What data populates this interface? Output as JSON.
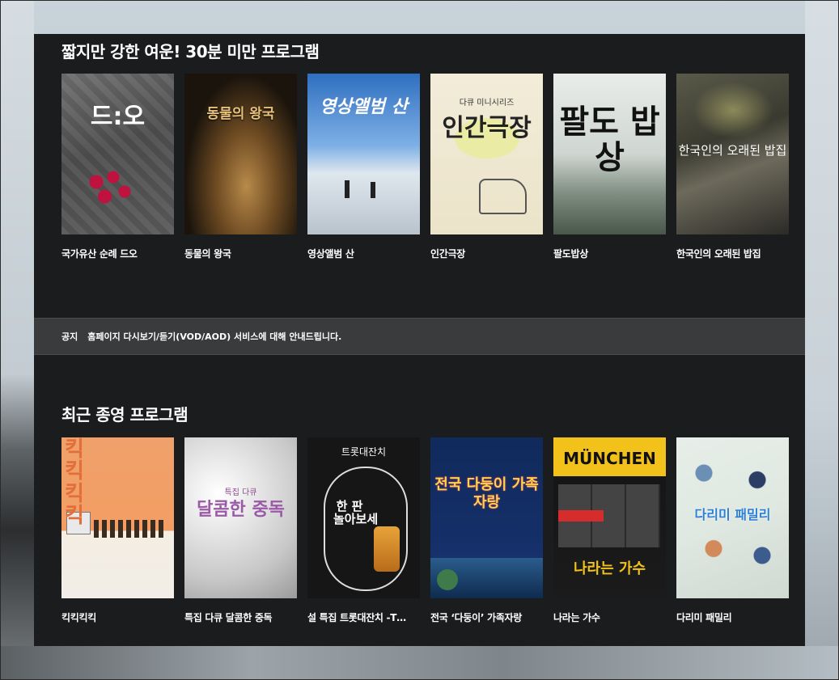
{
  "sections": [
    {
      "title": "짧지만 강한 여운! 30분 미만 프로그램",
      "items": [
        {
          "title": "국가유산 순례 드오",
          "poster_text": "드:오"
        },
        {
          "title": "동물의 왕국",
          "poster_text": "동물의 왕국"
        },
        {
          "title": "영상앨범 산",
          "poster_text": "영상앨범 산"
        },
        {
          "title": "인간극장",
          "poster_text": "인간극장",
          "poster_subtext": "다큐 미니시리즈"
        },
        {
          "title": "팔도밥상",
          "poster_text": "팔도 밥상"
        },
        {
          "title": "한국인의 오래된 밥집",
          "poster_text": "한국인의 오래된 밥집"
        }
      ]
    },
    {
      "title": "최근 종영 프로그램",
      "items": [
        {
          "title": "킥킥킥킥",
          "poster_text": "킥 킥 킥 킥"
        },
        {
          "title": "특집 다큐 달콤한 중독",
          "poster_text": "달콤한 중독",
          "poster_subtext": "특집 다큐"
        },
        {
          "title": "설 특집 트롯대잔치 -T…",
          "poster_text": "한 판 놀아보세",
          "poster_subtext": "트롯대잔치"
        },
        {
          "title": "전국 ‘다둥이’ 가족자랑",
          "poster_text": "전국 다둥이 가족자랑"
        },
        {
          "title": "나라는 가수",
          "poster_text": "나라는 가수",
          "poster_subtext": "MÜNCHEN"
        },
        {
          "title": "다리미 패밀리",
          "poster_text": "다리미 패밀리"
        }
      ]
    }
  ],
  "notice": {
    "label": "공지",
    "text": "홈페이지 다시보기/듣기(VOD/AOD) 서비스에 대해 안내드립니다."
  }
}
